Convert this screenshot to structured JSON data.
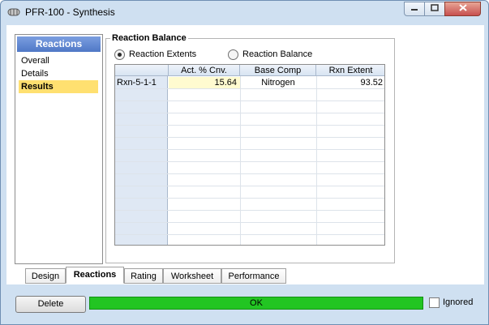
{
  "window": {
    "title": "PFR-100 - Synthesis",
    "app_icon": "pfr-reactor-icon",
    "controls": {
      "minimize": "minimize-icon",
      "maximize": "maximize-icon",
      "close": "close-icon"
    }
  },
  "nav": {
    "header": "Reactions",
    "items": [
      {
        "label": "Overall",
        "selected": false
      },
      {
        "label": "Details",
        "selected": false
      },
      {
        "label": "Results",
        "selected": true
      }
    ]
  },
  "balance": {
    "group_title": "Reaction Balance",
    "radios": [
      {
        "label": "Reaction Extents",
        "checked": true
      },
      {
        "label": "Reaction Balance",
        "checked": false
      }
    ],
    "table": {
      "columns": [
        "",
        "Act. % Cnv.",
        "Base Comp",
        "Rxn Extent"
      ],
      "rows": [
        {
          "name": "Rxn-5-1-1",
          "act_cnv": "15.64",
          "base_comp": "Nitrogen",
          "rxn_extent": "93.52"
        }
      ]
    }
  },
  "tabs": [
    {
      "label": "Design",
      "active": false
    },
    {
      "label": "Reactions",
      "active": true
    },
    {
      "label": "Rating",
      "active": false
    },
    {
      "label": "Worksheet",
      "active": false
    },
    {
      "label": "Performance",
      "active": false
    }
  ],
  "footer": {
    "delete_label": "Delete",
    "status_text": "OK",
    "status_color": "#22c522",
    "ignored_label": "Ignored",
    "ignored_checked": false
  },
  "colors": {
    "nav_header": "#4f78c6",
    "selected_item": "#ffe070",
    "window_frame": "#cfe0f1"
  }
}
